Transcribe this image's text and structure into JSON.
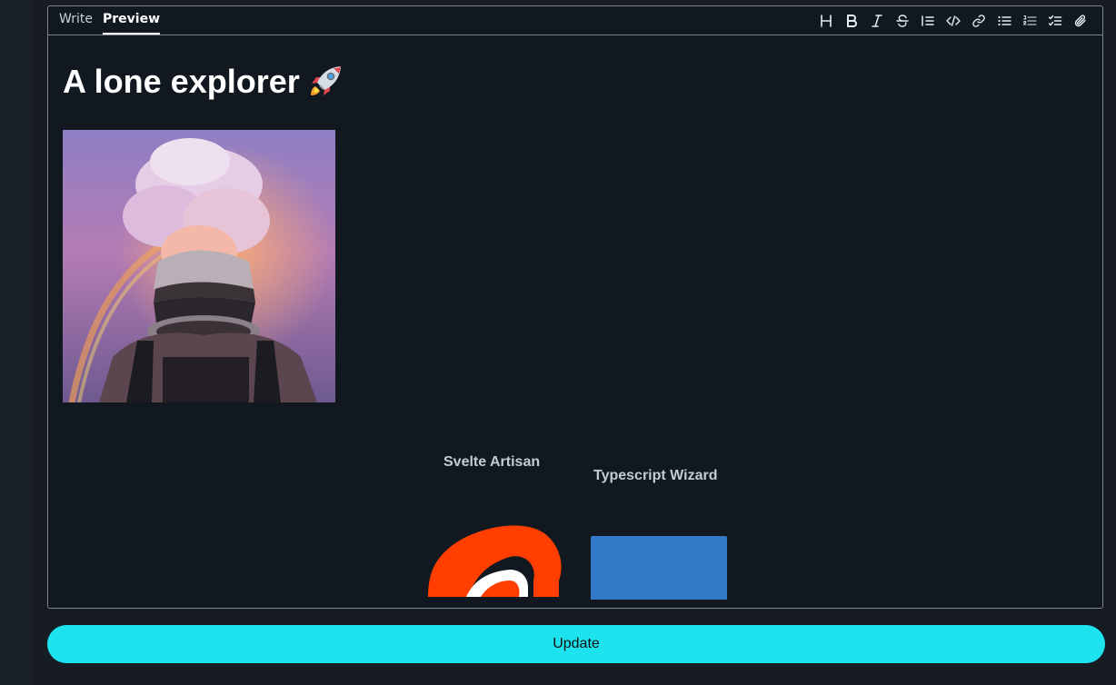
{
  "editor": {
    "tabs": [
      {
        "label": "Write",
        "active": false
      },
      {
        "label": "Preview",
        "active": true
      }
    ],
    "toolbar": [
      {
        "icon": "heading-icon"
      },
      {
        "icon": "bold-icon"
      },
      {
        "icon": "italic-icon"
      },
      {
        "icon": "strikethrough-icon"
      },
      {
        "icon": "quote-icon"
      },
      {
        "icon": "code-icon"
      },
      {
        "icon": "link-icon"
      },
      {
        "icon": "bulleted-list-icon"
      },
      {
        "icon": "numbered-list-icon"
      },
      {
        "icon": "task-list-icon"
      },
      {
        "icon": "attachment-icon"
      }
    ]
  },
  "preview": {
    "title": "A lone explorer",
    "title_emoji": "rocket-icon",
    "image": "astronaut-cloud-image",
    "cards": [
      {
        "label": "Svelte Artisan",
        "logo": "svelte-logo"
      },
      {
        "label": "Typescript Wizard",
        "logo": "typescript-logo"
      }
    ]
  },
  "actions": {
    "update_label": "Update"
  },
  "colors": {
    "accent": "#1de3ee",
    "background": "#111820",
    "border": "#7d858f",
    "svelte": "#ff3e00",
    "typescript": "#3178c6"
  }
}
